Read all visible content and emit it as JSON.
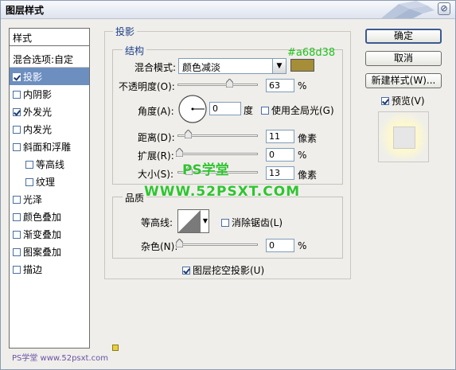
{
  "window": {
    "title": "图层样式",
    "close": "⊘"
  },
  "sidebar": {
    "header": "样式",
    "blend_options": "混合选项:自定",
    "items": [
      {
        "label": "投影",
        "checked": true,
        "selected": true
      },
      {
        "label": "内阴影",
        "checked": false
      },
      {
        "label": "外发光",
        "checked": true
      },
      {
        "label": "内发光",
        "checked": false
      },
      {
        "label": "斜面和浮雕",
        "checked": false
      },
      {
        "label": "等高线",
        "checked": false,
        "indent": true
      },
      {
        "label": "纹理",
        "checked": false,
        "indent": true
      },
      {
        "label": "光泽",
        "checked": false
      },
      {
        "label": "颜色叠加",
        "checked": false
      },
      {
        "label": "渐变叠加",
        "checked": false
      },
      {
        "label": "图案叠加",
        "checked": false
      },
      {
        "label": "描边",
        "checked": false
      }
    ]
  },
  "drop_shadow": {
    "section_title": "投影",
    "structure": {
      "title": "结构",
      "blend_mode_label": "混合模式:",
      "blend_mode_value": "颜色减淡",
      "color_hex_text": "#a68d38",
      "color": "#a68d38",
      "opacity_label": "不透明度(O):",
      "opacity_value": "63",
      "opacity_unit": "%",
      "angle_label": "角度(A):",
      "angle_value": "0",
      "angle_unit": "度",
      "use_global_light_label": "使用全局光(G)",
      "use_global_light_checked": false,
      "distance_label": "距离(D):",
      "distance_value": "11",
      "distance_unit": "像素",
      "spread_label": "扩展(R):",
      "spread_value": "0",
      "spread_unit": "%",
      "size_label": "大小(S):",
      "size_value": "13",
      "size_unit": "像素"
    },
    "quality": {
      "title": "品质",
      "contour_label": "等高线:",
      "anti_alias_label": "消除锯齿(L)",
      "anti_alias_checked": false,
      "noise_label": "杂色(N):",
      "noise_value": "0",
      "noise_unit": "%"
    },
    "knockout_label": "图层挖空投影(U)",
    "knockout_checked": true
  },
  "buttons": {
    "ok": "确定",
    "cancel": "取消",
    "new_style": "新建样式(W)...",
    "preview_label": "预览(V)",
    "preview_checked": true
  },
  "watermarks": {
    "brand": "PS学堂",
    "url": "WWW.52PSXT.COM",
    "footer": "PS学堂 www.52psxt.com"
  }
}
